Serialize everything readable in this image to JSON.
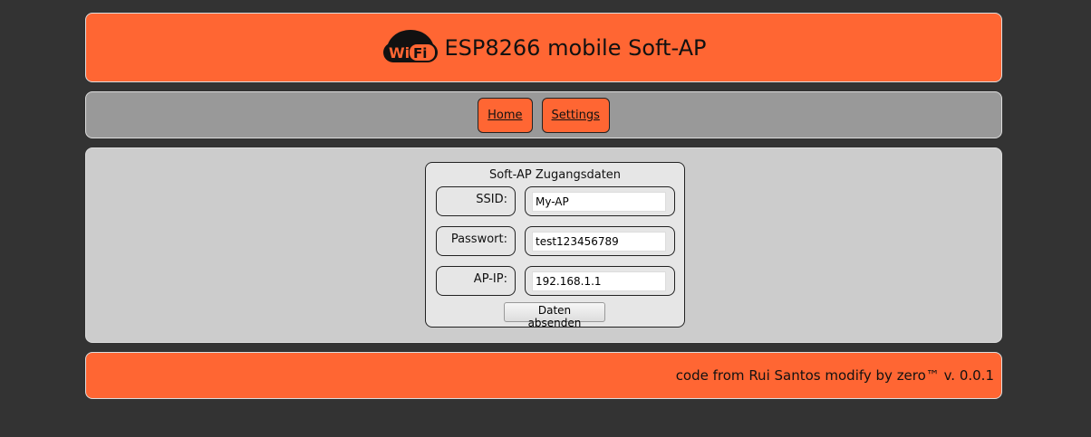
{
  "header": {
    "title": "ESP8266 mobile Soft-AP",
    "logo_text": "WiFi"
  },
  "nav": [
    {
      "label": "Home"
    },
    {
      "label": "Settings"
    }
  ],
  "form": {
    "title": "Soft-AP Zugangsdaten",
    "fields": [
      {
        "label": "SSID:",
        "value": "My-AP"
      },
      {
        "label": "Passwort:",
        "value": "test123456789"
      },
      {
        "label": "AP-IP:",
        "value": "192.168.1.1"
      }
    ],
    "submit": "Daten absenden"
  },
  "footer": {
    "prefix": "code from ",
    "author": "Rui Santos",
    "middle": " modify by ",
    "modifier": "zero™",
    "version": " v. 0.0.1"
  },
  "colors": {
    "accent": "#ff6633",
    "background": "#333333"
  }
}
